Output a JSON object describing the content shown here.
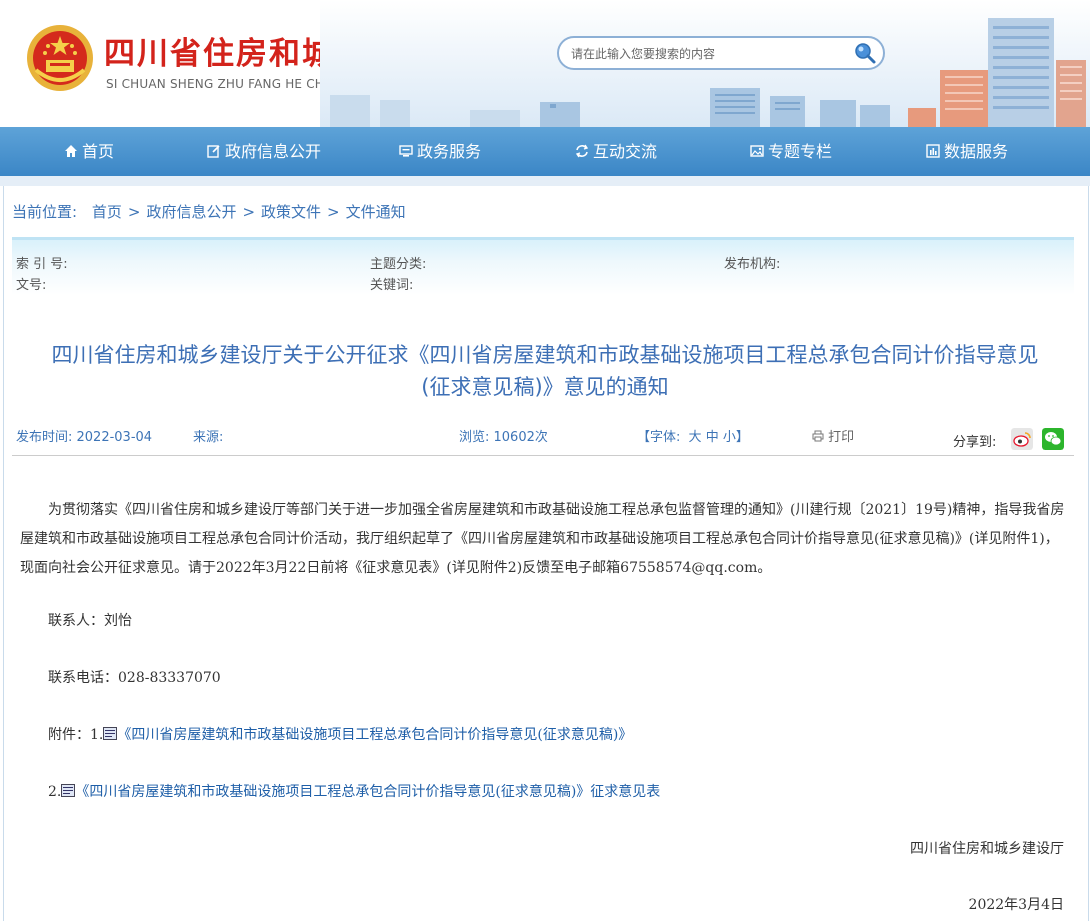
{
  "header": {
    "site_title": "四川省住房和城乡建设厅",
    "site_pinyin": "SI CHUAN SHENG ZHU FANG HE CHENG XIANG JIAN SHE TING",
    "search_placeholder": "请在此输入您要搜索的内容"
  },
  "nav": {
    "items": [
      {
        "label": "首页",
        "icon": "home-icon"
      },
      {
        "label": "政府信息公开",
        "icon": "edit-icon"
      },
      {
        "label": "政务服务",
        "icon": "monitor-icon"
      },
      {
        "label": "互动交流",
        "icon": "exchange-icon"
      },
      {
        "label": "专题专栏",
        "icon": "image-icon"
      },
      {
        "label": "数据服务",
        "icon": "chart-icon"
      }
    ]
  },
  "breadcrumb": {
    "label": "当前位置:",
    "items": [
      "首页",
      "政府信息公开",
      "政策文件",
      "文件通知"
    ],
    "separator": ">"
  },
  "meta": {
    "index_no": "索 引 号:",
    "topic": "主题分类:",
    "publisher": "发布机构:",
    "doc_no": "文号:",
    "keywords": "关键词:"
  },
  "article": {
    "title_line1": "四川省住房和城乡建设厅关于公开征求《四川省房屋建筑和市政基础设施项目工程总承包合同计价指导意见",
    "title_line2": "(征求意见稿)》意见的通知",
    "publish_time": "发布时间: 2022-03-04",
    "source": "来源:",
    "views": "浏览: 10602次",
    "font_label": "【字体:",
    "font_large": "大",
    "font_medium": "中",
    "font_small": "小】",
    "print": "打印",
    "share_label": "分享到:",
    "paragraph": "为贯彻落实《四川省住房和城乡建设厅等部门关于进一步加强全省房屋建筑和市政基础设施工程总承包监督管理的通知》(川建行规〔2021〕19号)精神，指导我省房屋建筑和市政基础设施项目工程总承包合同计价活动，我厅组织起草了《四川省房屋建筑和市政基础设施项目工程总承包合同计价指导意见(征求意见稿)》(详见附件1)，现面向社会公开征求意见。请于2022年3月22日前将《征求意见表》(详见附件2)反馈至电子邮箱67558574@qq.com。",
    "contact": "联系人：刘怡",
    "phone": "联系电话：028-83337070",
    "attach_prefix": "附件：1.",
    "attach1": "《四川省房屋建筑和市政基础设施项目工程总承包合同计价指导意见(征求意见稿)》",
    "attach2_prefix": "2.",
    "attach2": "《四川省房屋建筑和市政基础设施项目工程总承包合同计价指导意见(征求意见稿)》征求意见表",
    "signature": "四川省住房和城乡建设厅",
    "date": "2022年3月4日"
  },
  "colors": {
    "title_red": "#d3231b",
    "nav_blue": "#3b86c6",
    "link_blue": "#3d74b6"
  }
}
